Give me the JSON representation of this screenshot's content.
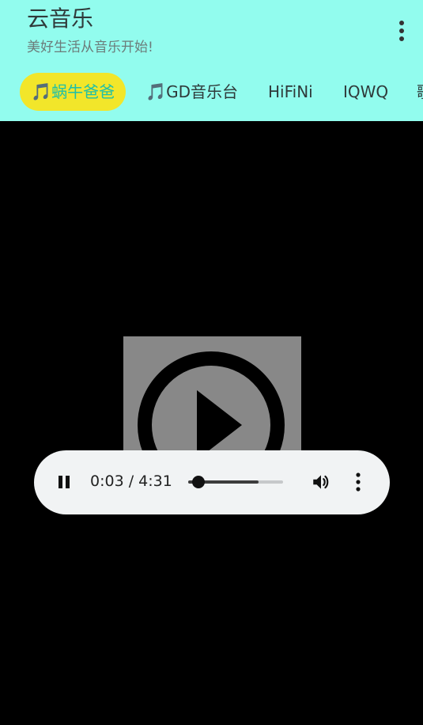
{
  "app": {
    "title": "云音乐",
    "subtitle": "美好生活从音乐开始!",
    "menu_icon": "more-vert-icon"
  },
  "tabs": [
    {
      "icon": "🎵",
      "label": "蜗牛爸爸",
      "active": true
    },
    {
      "icon": "🎵",
      "label": "GD音乐台",
      "active": false
    },
    {
      "icon": "",
      "label": "HiFiNi",
      "active": false
    },
    {
      "icon": "",
      "label": "IQWQ",
      "active": false
    },
    {
      "icon": "",
      "label": "歌",
      "active": false
    }
  ],
  "player": {
    "poster_icon": "play-circle-icon",
    "state_icon": "pause-icon",
    "time": "0:03 / 4:31",
    "current": "0:03",
    "duration": "4:31",
    "progress_fraction": 0.011,
    "volume_icon": "volume-up-icon",
    "more_icon": "more-vert-icon"
  },
  "colors": {
    "header_bg": "#92fcee",
    "active_tab_bg": "#f2e62a",
    "active_tab_text": "#1fbfa8",
    "controls_bg": "#f1f3f4",
    "video_bg": "#000000"
  }
}
